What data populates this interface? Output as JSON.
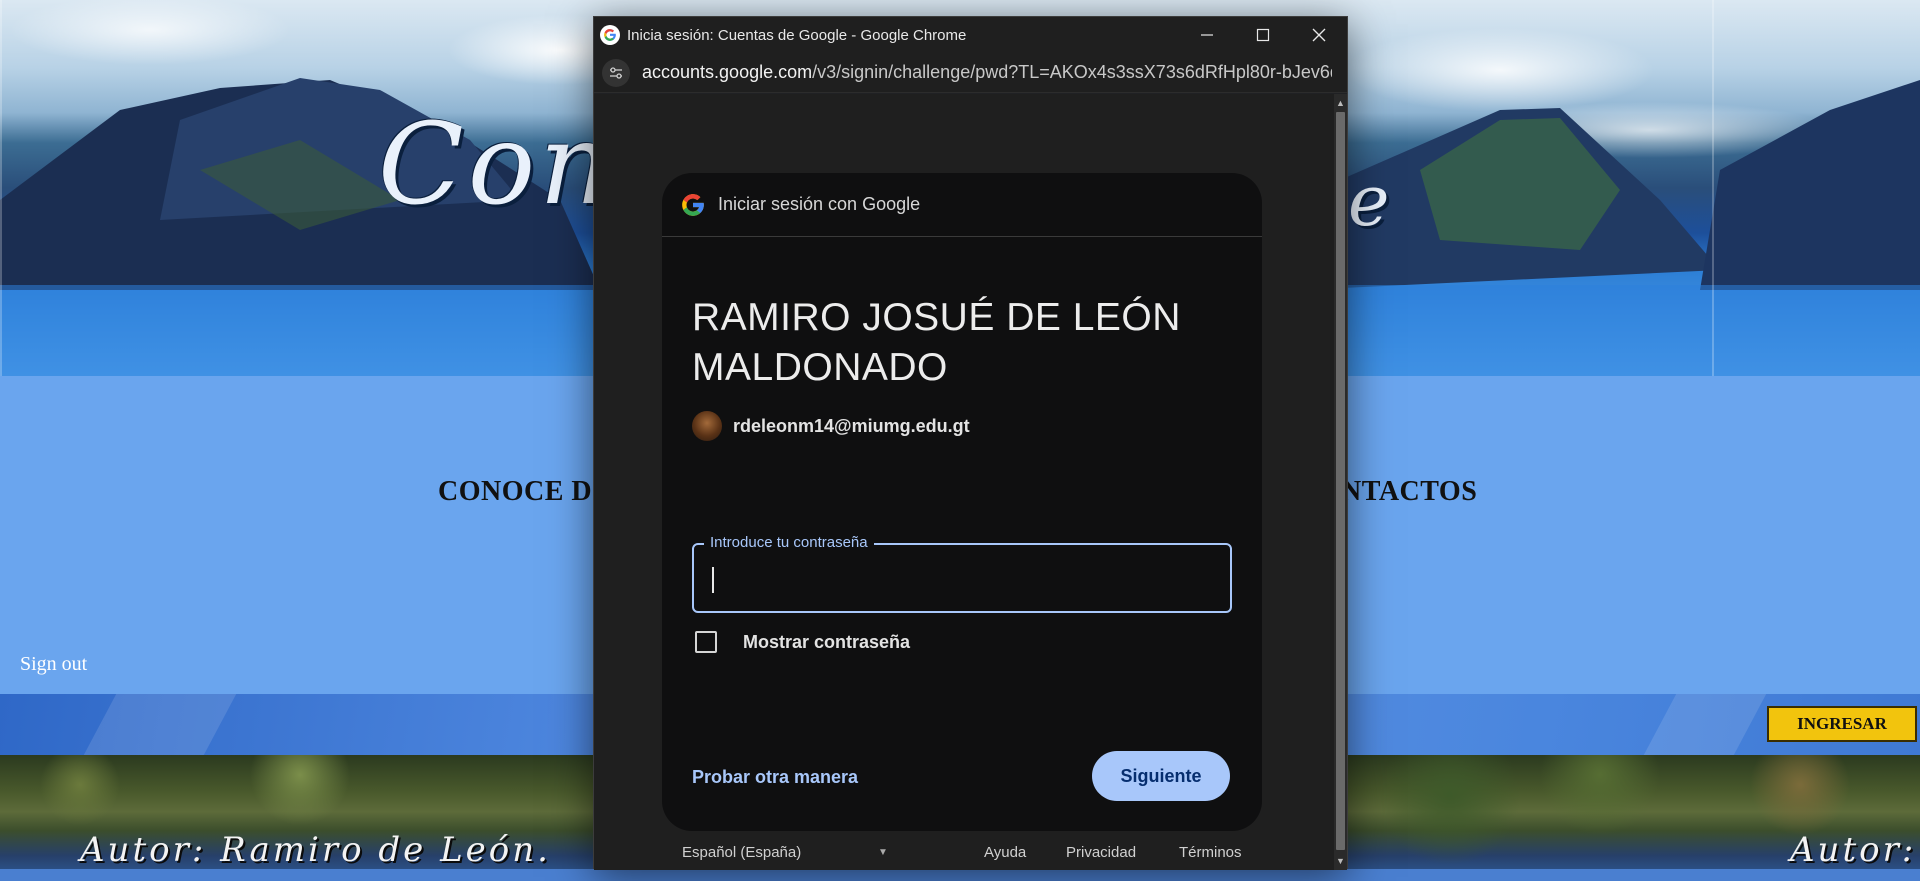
{
  "site": {
    "logo_left": "Con",
    "logo_right": "e",
    "nav_left": "CONOCE D",
    "nav_right": "NTACTOS",
    "signout": "Sign out",
    "ingresar": "INGRESAR",
    "autor_left": "Autor: Ramiro de León.",
    "autor_right": "Autor:"
  },
  "window": {
    "title": "Inicia sesión: Cuentas de Google - Google Chrome",
    "url_host": "accounts.google.com",
    "url_path": "/v3/signin/challenge/pwd?TL=AKOx4s3ssX73s6dRfHpl80r-bJev6d..."
  },
  "signin": {
    "header": "Iniciar sesión con Google",
    "user_name": "RAMIRO JOSUÉ DE LEÓN MALDONADO",
    "email": "rdeleonm14@miumg.edu.gt",
    "password_label": "Introduce tu contraseña",
    "password_value": "",
    "show_password_label": "Mostrar contraseña",
    "show_password_checked": false,
    "try_other": "Probar otra manera",
    "next": "Siguiente",
    "language": "Español (España)",
    "help": "Ayuda",
    "privacy": "Privacidad",
    "terms": "Términos"
  },
  "colors": {
    "accent": "#a8c7fa",
    "ingresar_bg": "#f2c40d",
    "page_bg": "#6aa5ee"
  }
}
